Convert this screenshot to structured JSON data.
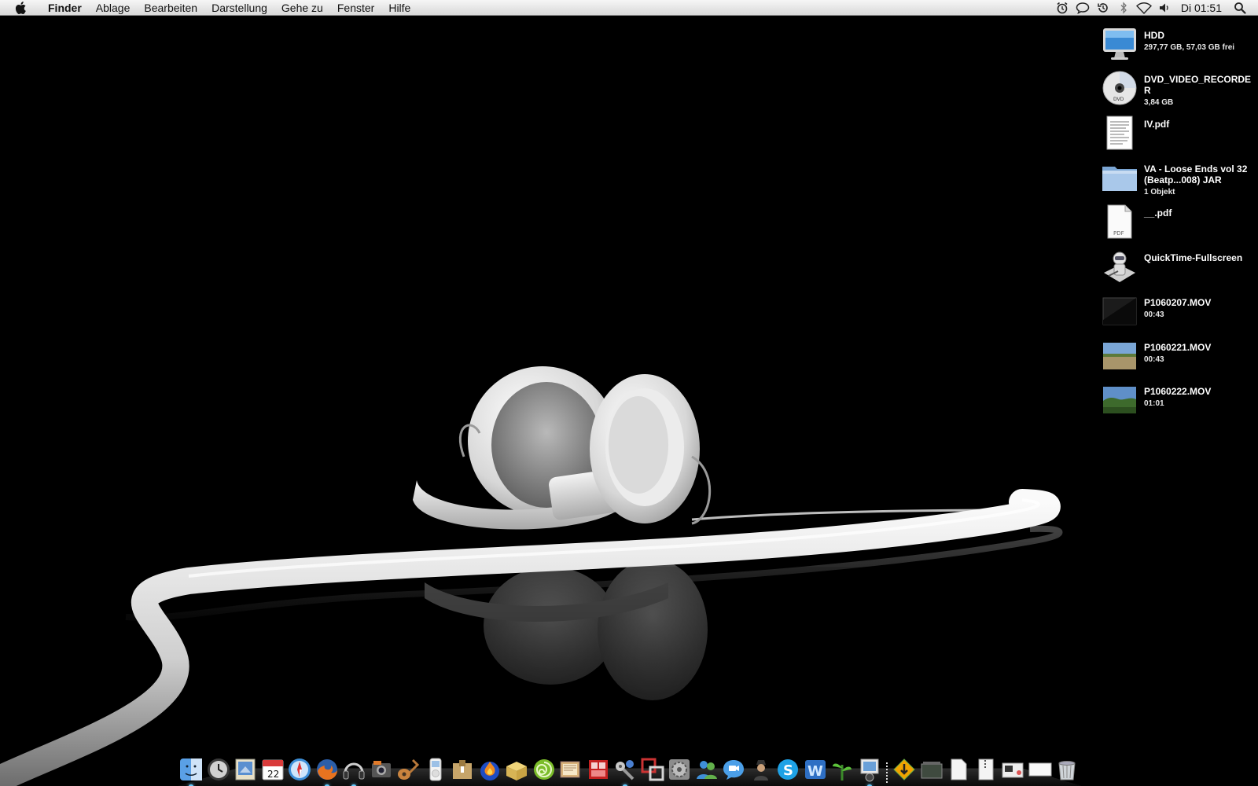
{
  "menubar": {
    "app_name": "Finder",
    "menus": [
      "Ablage",
      "Bearbeiten",
      "Darstellung",
      "Gehe zu",
      "Fenster",
      "Hilfe"
    ],
    "status_icons": [
      "alarm-clock-icon",
      "speech-bubble-icon",
      "time-machine-icon",
      "bluetooth-icon",
      "wifi-icon",
      "volume-icon"
    ],
    "clock": "Di 01:51"
  },
  "desktop": {
    "items": [
      {
        "name": "HDD",
        "info": "297,77 GB, 57,03 GB frei",
        "icon": "imac-hard-drive-icon"
      },
      {
        "name": "DVD_VIDEO_RECORDER",
        "info": "3,84 GB",
        "icon": "dvd-disc-icon"
      },
      {
        "name": "IV.pdf",
        "info": "",
        "icon": "pdf-document-icon"
      },
      {
        "name": "VA - Loose Ends vol 32 (Beatp...008) JAR",
        "info": "1 Objekt",
        "icon": "folder-icon"
      },
      {
        "name": "__.pdf",
        "info": "",
        "icon": "pdf-file-icon"
      },
      {
        "name": "QuickTime-Fullscreen",
        "info": "",
        "icon": "automator-robot-icon"
      },
      {
        "name": "P1060207.MOV",
        "info": "00:43",
        "icon": "video-thumbnail-dark-icon"
      },
      {
        "name": "P1060221.MOV",
        "info": "00:43",
        "icon": "video-thumbnail-field-icon"
      },
      {
        "name": "P1060222.MOV",
        "info": "01:01",
        "icon": "video-thumbnail-landscape-icon"
      }
    ]
  },
  "dock": {
    "apps": [
      {
        "icon": "finder-icon",
        "running": true
      },
      {
        "icon": "time-machine-icon",
        "running": false
      },
      {
        "icon": "mail-stamp-icon",
        "running": false
      },
      {
        "icon": "ical-icon",
        "running": false,
        "label": "22"
      },
      {
        "icon": "safari-icon",
        "running": false
      },
      {
        "icon": "firefox-icon",
        "running": true
      },
      {
        "icon": "headphones-icon",
        "running": true
      },
      {
        "icon": "iphoto-icon",
        "running": false
      },
      {
        "icon": "garageband-icon",
        "running": false
      },
      {
        "icon": "ipod-icon",
        "running": false
      },
      {
        "icon": "preview-icon",
        "running": false
      },
      {
        "icon": "burn-icon",
        "running": false
      },
      {
        "icon": "mail-package-icon",
        "running": false
      },
      {
        "icon": "chartreuse-spiral-icon",
        "running": false
      },
      {
        "icon": "iphoto-album-icon",
        "running": false
      },
      {
        "icon": "photo-booth-icon",
        "running": false
      },
      {
        "icon": "utilities-icon",
        "running": true
      },
      {
        "icon": "remote-desktop-icon",
        "running": false
      },
      {
        "icon": "system-preferences-icon",
        "running": false
      },
      {
        "icon": "messenger-icon",
        "running": false
      },
      {
        "icon": "ichat-icon",
        "running": false
      },
      {
        "icon": "user-icon",
        "running": false
      },
      {
        "icon": "skype-icon",
        "running": false
      },
      {
        "icon": "word-icon",
        "running": false
      },
      {
        "icon": "plant-icon",
        "running": false
      },
      {
        "icon": "preview-photos-icon",
        "running": true
      }
    ],
    "docs": [
      {
        "icon": "transmit-icon"
      },
      {
        "icon": "image-stack-icon"
      },
      {
        "icon": "document-icon"
      },
      {
        "icon": "zip-document-icon"
      },
      {
        "icon": "folder-stack-icon"
      },
      {
        "icon": "blank-document-icon"
      },
      {
        "icon": "trash-icon"
      }
    ]
  }
}
